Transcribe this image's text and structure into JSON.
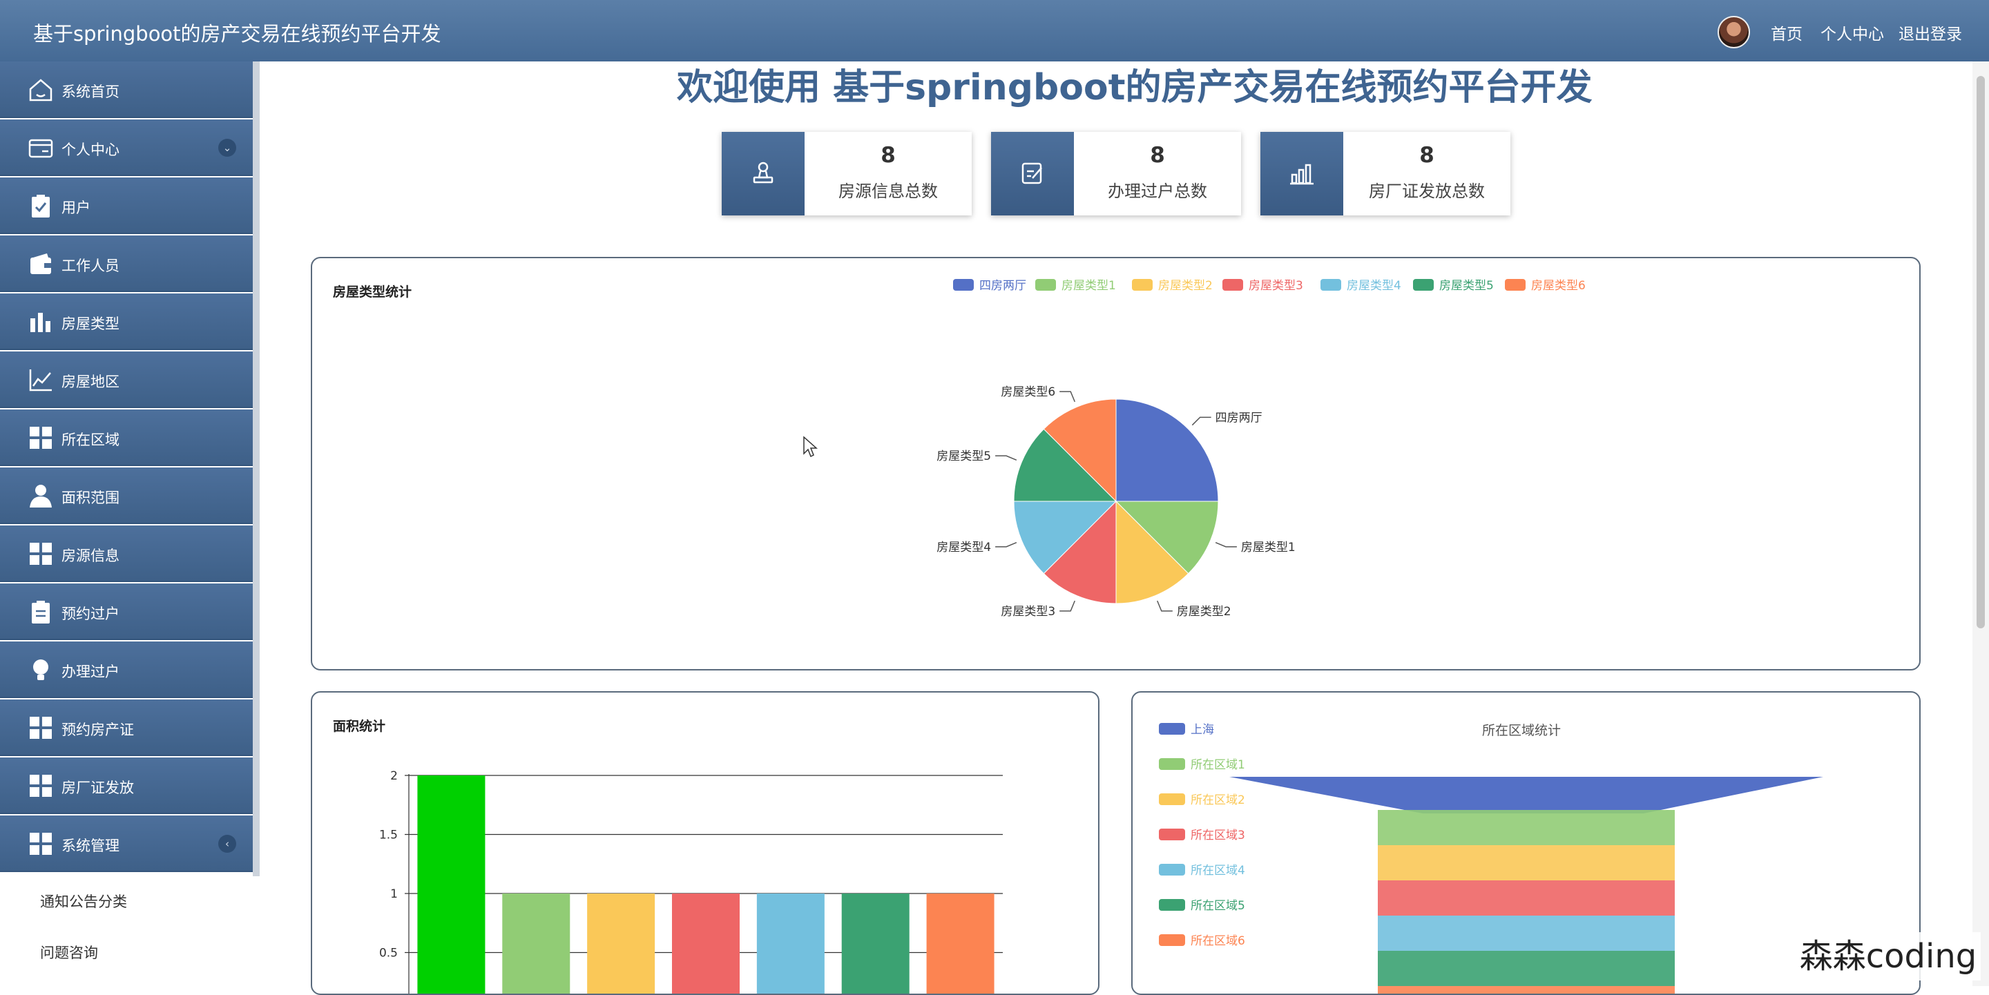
{
  "header": {
    "app_title": "基于springboot的房产交易在线预约平台开发",
    "links": [
      "首页",
      "个人中心",
      "退出登录"
    ]
  },
  "sidebar": {
    "items": [
      {
        "label": "系统首页",
        "icon": "home-icon"
      },
      {
        "label": "个人中心",
        "icon": "card-icon",
        "arrow": "⌄"
      },
      {
        "label": "用户",
        "icon": "clipboard-check-icon"
      },
      {
        "label": "工作人员",
        "icon": "wallet-icon"
      },
      {
        "label": "房屋类型",
        "icon": "bar-chart-icon"
      },
      {
        "label": "房屋地区",
        "icon": "line-chart-icon"
      },
      {
        "label": "所在区域",
        "icon": "grid-icon"
      },
      {
        "label": "面积范围",
        "icon": "user-icon"
      },
      {
        "label": "房源信息",
        "icon": "grid-icon"
      },
      {
        "label": "预约过户",
        "icon": "clipboard-icon"
      },
      {
        "label": "办理过户",
        "icon": "bulb-icon"
      },
      {
        "label": "预约房产证",
        "icon": "grid-icon"
      },
      {
        "label": "房厂证发放",
        "icon": "grid-icon"
      },
      {
        "label": "系统管理",
        "icon": "grid-icon",
        "arrow": "‹"
      }
    ],
    "sub_items": [
      "通知公告分类",
      "问题咨询"
    ]
  },
  "main": {
    "welcome": "欢迎使用 基于springboot的房产交易在线预约平台开发",
    "stats": [
      {
        "value": "8",
        "label": "房源信息总数",
        "icon": "stamp-icon"
      },
      {
        "value": "8",
        "label": "办理过户总数",
        "icon": "edit-icon"
      },
      {
        "value": "8",
        "label": "房厂证发放总数",
        "icon": "bar-chart-icon"
      }
    ]
  },
  "chart_data": [
    {
      "type": "pie",
      "title": "房屋类型统计",
      "categories": [
        "四房两厅",
        "房屋类型1",
        "房屋类型2",
        "房屋类型3",
        "房屋类型4",
        "房屋类型5",
        "房屋类型6"
      ],
      "values": [
        2,
        1,
        1,
        1,
        1,
        1,
        1
      ],
      "colors": [
        "#5470c6",
        "#91cc75",
        "#fac858",
        "#ee6666",
        "#73c0de",
        "#3ba272",
        "#fc8452"
      ],
      "legend": "top-right"
    },
    {
      "type": "bar",
      "title": "面积统计",
      "values": [
        2,
        1,
        1,
        1,
        1,
        1,
        1
      ],
      "colors": [
        "#00d000",
        "#91cc75",
        "#fac858",
        "#ee6666",
        "#73c0de",
        "#3ba272",
        "#fc8452"
      ],
      "ylim": [
        0,
        2
      ],
      "yticks": [
        "2",
        "1.5",
        "1",
        "0.5"
      ],
      "grid": true
    },
    {
      "type": "funnel",
      "title": "所在区域统计",
      "categories": [
        "上海",
        "所在区域1",
        "所在区域2",
        "所在区域3",
        "所在区域4",
        "所在区域5",
        "所在区域6"
      ],
      "colors": [
        "#5470c6",
        "#91cc75",
        "#fac858",
        "#ee6666",
        "#73c0de",
        "#3ba272",
        "#fc8452"
      ],
      "legend": "left"
    }
  ],
  "watermark": "森森coding"
}
